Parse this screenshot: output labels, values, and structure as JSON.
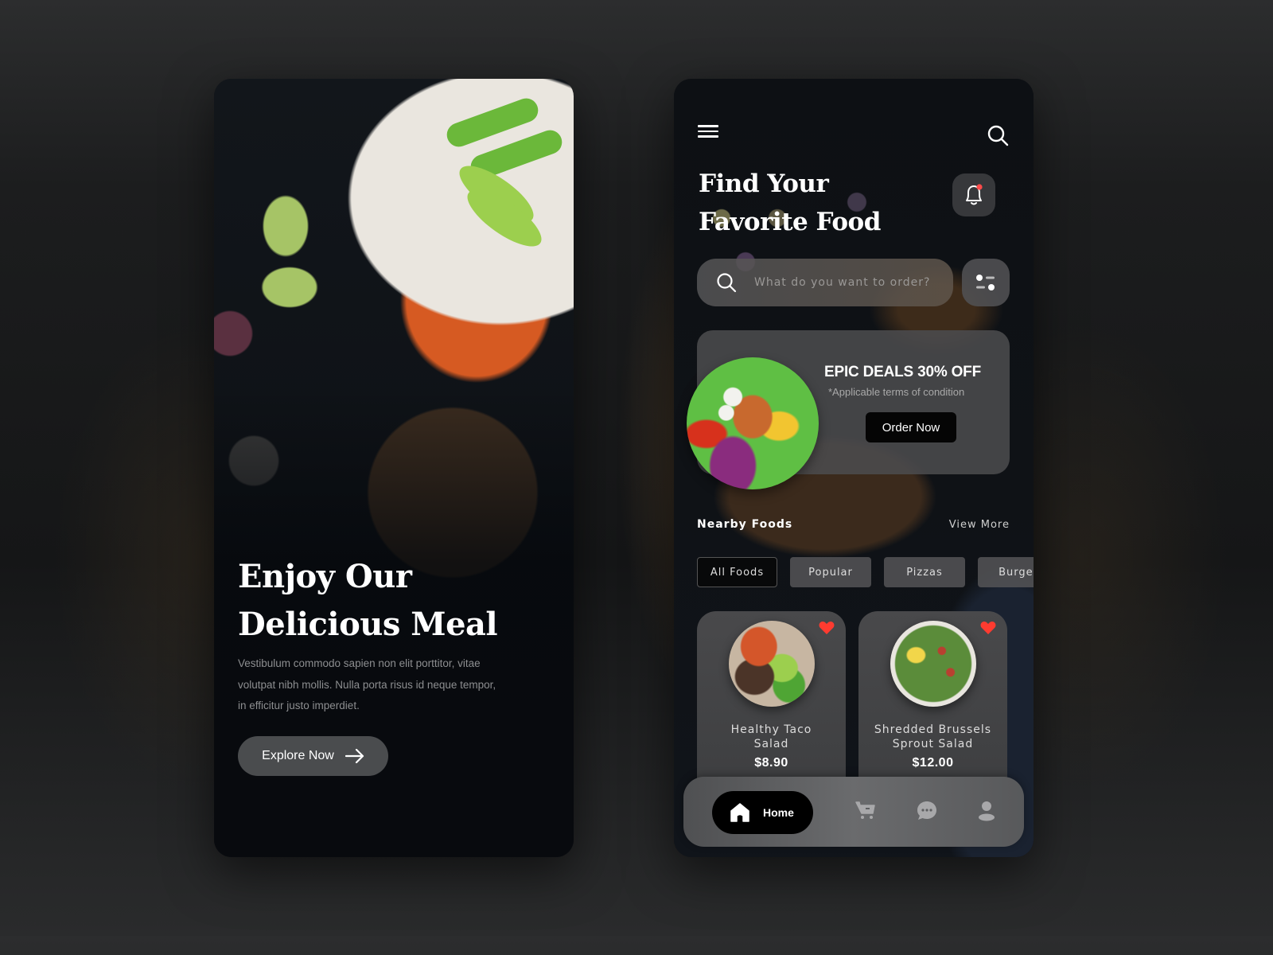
{
  "onboarding": {
    "title_line1": "Enjoy Our",
    "title_line2": "Delicious Meal",
    "description": "Vestibulum commodo sapien non elit porttitor, vitae volutpat nibh mollis. Nulla porta risus id neque tempor, in efficitur justo imperdiet.",
    "cta_label": "Explore Now",
    "cta_icon": "arrow-right-icon"
  },
  "home": {
    "header": {
      "menu_icon": "hamburger-menu-icon",
      "search_icon": "search-icon"
    },
    "title_line1": "Find Your",
    "title_line2": "Favorite Food",
    "notification": {
      "icon": "bell-icon",
      "has_unread": true,
      "badge_color": "#ff4b4b"
    },
    "search": {
      "placeholder": "What do you want to order?",
      "value": "",
      "filter_icon": "filter-icon"
    },
    "promo": {
      "title": "EPIC DEALS 30% OFF",
      "subtitle": "*Applicable terms of condition",
      "button_label": "Order Now"
    },
    "nearby": {
      "title": "Nearby Foods",
      "view_more_label": "View More",
      "filters": [
        {
          "label": "All Foods",
          "active": true
        },
        {
          "label": "Popular",
          "active": false
        },
        {
          "label": "Pizzas",
          "active": false
        },
        {
          "label": "Burger",
          "active": false
        }
      ],
      "items": [
        {
          "name_line1": "Healthy Taco",
          "name_line2": "Salad",
          "price": "$8.90",
          "favorite": true
        },
        {
          "name_line1": "Shredded Brussels",
          "name_line2": "Sprout Salad",
          "price": "$12.00",
          "favorite": true
        }
      ]
    },
    "bottom_nav": {
      "items": [
        {
          "label": "Home",
          "icon": "home-icon",
          "active": true
        },
        {
          "label": "",
          "icon": "cart-icon",
          "active": false
        },
        {
          "label": "",
          "icon": "chat-icon",
          "active": false
        },
        {
          "label": "",
          "icon": "profile-icon",
          "active": false
        }
      ]
    }
  },
  "colors": {
    "heart": "#ff3b30",
    "accent_dark": "#000000",
    "nav_inactive": "#a8a8aa"
  }
}
